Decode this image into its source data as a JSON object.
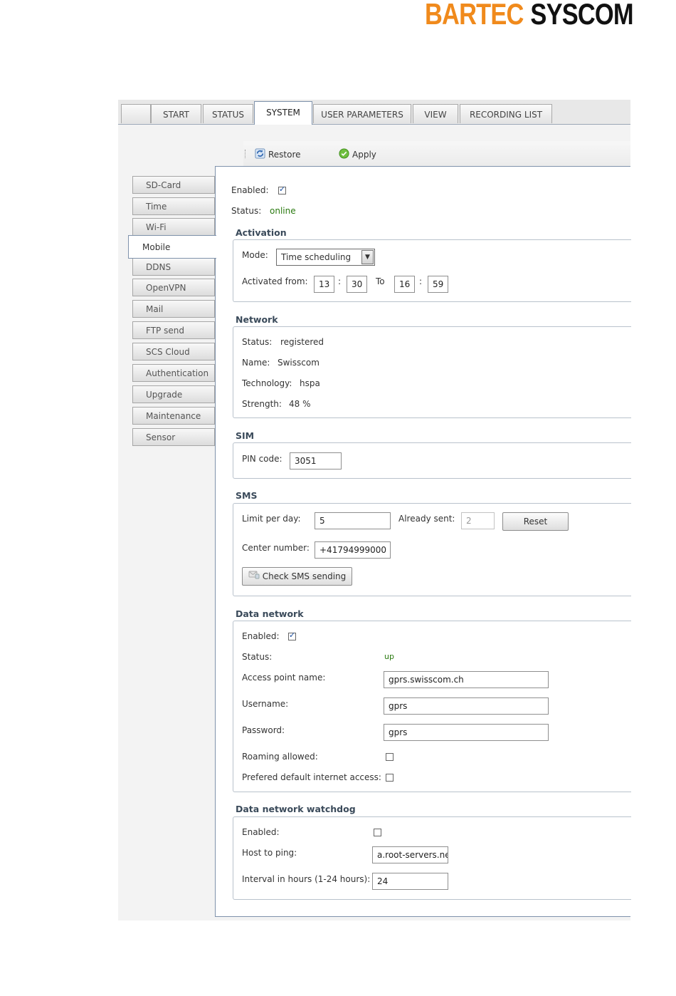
{
  "logo": {
    "part1": "BARTEC",
    "part2": "SYSCOM"
  },
  "tabs": [
    {
      "label": ""
    },
    {
      "label": "START"
    },
    {
      "label": "STATUS"
    },
    {
      "label": "SYSTEM"
    },
    {
      "label": "USER PARAMETERS"
    },
    {
      "label": "VIEW"
    },
    {
      "label": "RECORDING LIST"
    }
  ],
  "toolbar": {
    "restore": "Restore",
    "apply": "Apply"
  },
  "sidebar": [
    "SD-Card",
    "Time",
    "Wi-Fi",
    "Mobile",
    "DDNS",
    "OpenVPN",
    "Mail",
    "FTP send",
    "SCS Cloud",
    "Authentication",
    "Upgrade",
    "Maintenance",
    "Sensor"
  ],
  "top": {
    "enabled_label": "Enabled:",
    "status_label": "Status:",
    "status_value": "online"
  },
  "activation": {
    "title": "Activation",
    "mode_label": "Mode:",
    "mode_value": "Time scheduling",
    "from_label": "Activated from:",
    "from_h": "13",
    "from_m": "30",
    "to_label": "To",
    "to_h": "16",
    "to_m": "59",
    "colon": ":"
  },
  "network": {
    "title": "Network",
    "status_label": "Status:",
    "status_value": "registered",
    "name_label": "Name:",
    "name_value": "Swisscom",
    "tech_label": "Technology:",
    "tech_value": "hspa",
    "strength_label": "Strength:",
    "strength_value": "48 %"
  },
  "sim": {
    "title": "SIM",
    "pin_label": "PIN code:",
    "pin_value": "3051"
  },
  "sms": {
    "title": "SMS",
    "limit_label": "Limit per day:",
    "limit_value": "5",
    "sent_label": "Already sent:",
    "sent_value": "2",
    "reset": "Reset",
    "center_label": "Center number:",
    "center_value": "+41794999000",
    "check": "Check SMS sending"
  },
  "data_network": {
    "title": "Data network",
    "enabled_label": "Enabled:",
    "status_label": "Status:",
    "status_value": "up",
    "apn_label": "Access point name:",
    "apn_value": "gprs.swisscom.ch",
    "user_label": "Username:",
    "user_value": "gprs",
    "pass_label": "Password:",
    "pass_value": "gprs",
    "roaming_label": "Roaming allowed:",
    "default_label": "Prefered default internet access:"
  },
  "watchdog": {
    "title": "Data network watchdog",
    "enabled_label": "Enabled:",
    "host_label": "Host to ping:",
    "host_value": "a.root-servers.net",
    "interval_label": "Interval in hours (1-24 hours):",
    "interval_value": "24"
  },
  "colors": {
    "brand_orange": "#f08a1c",
    "status_green": "#2a7a10",
    "frame_border": "#7f92ab"
  },
  "icons": {
    "restore": "refresh-icon",
    "apply": "check-circle-icon",
    "check_sms": "sms-icon"
  }
}
